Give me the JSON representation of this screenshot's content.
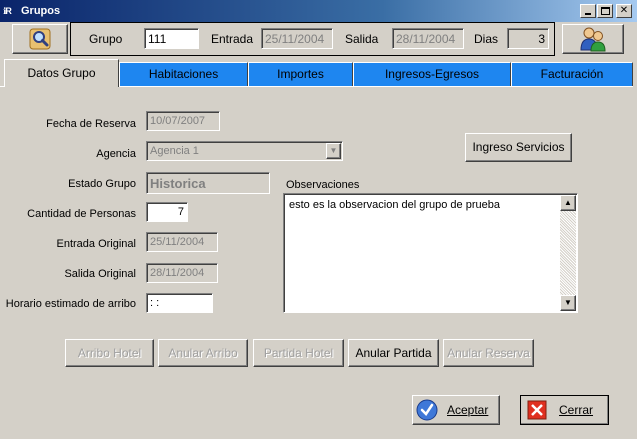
{
  "window": {
    "title": "Grupos",
    "app_icon_text": "ℹR"
  },
  "header": {
    "grupo_label": "Grupo",
    "grupo_value": "111",
    "entrada_label": "Entrada",
    "entrada_value": "25/11/2004",
    "salida_label": "Salida",
    "salida_value": "28/11/2004",
    "dias_label": "Dias",
    "dias_value": "3"
  },
  "tabs": [
    {
      "label": "Datos Grupo",
      "active": true
    },
    {
      "label": "Habitaciones"
    },
    {
      "label": "Importes"
    },
    {
      "label": "Ingresos-Egresos"
    },
    {
      "label": "Facturación"
    }
  ],
  "form": {
    "fecha_reserva_label": "Fecha de Reserva",
    "fecha_reserva_value": "10/07/2007",
    "agencia_label": "Agencia",
    "agencia_value": "Agencia 1",
    "estado_label": "Estado Grupo",
    "estado_value": "Historica",
    "cantidad_label": "Cantidad de Personas",
    "cantidad_value": "7",
    "entrada_original_label": "Entrada Original",
    "entrada_original_value": "25/11/2004",
    "salida_original_label": "Salida Original",
    "salida_original_value": "28/11/2004",
    "horario_label": "Horario estimado de arribo",
    "horario_value": " : :",
    "observaciones_label": "Observaciones",
    "observaciones_value": "esto es la observacion del grupo de prueba",
    "ingreso_servicios_label": "Ingreso Servicios"
  },
  "actions": {
    "arribo_hotel": "Arribo Hotel",
    "anular_arribo": "Anular Arribo",
    "partida_hotel": "Partida Hotel",
    "anular_partida": "Anular Partida",
    "anular_reserva": "Anular Reserva",
    "aceptar": "Aceptar",
    "cerrar": "Cerrar"
  },
  "colors": {
    "tab_inactive": "#1e86f0",
    "window_bg": "#d4d0c8",
    "title_bar": "#0a246a"
  }
}
